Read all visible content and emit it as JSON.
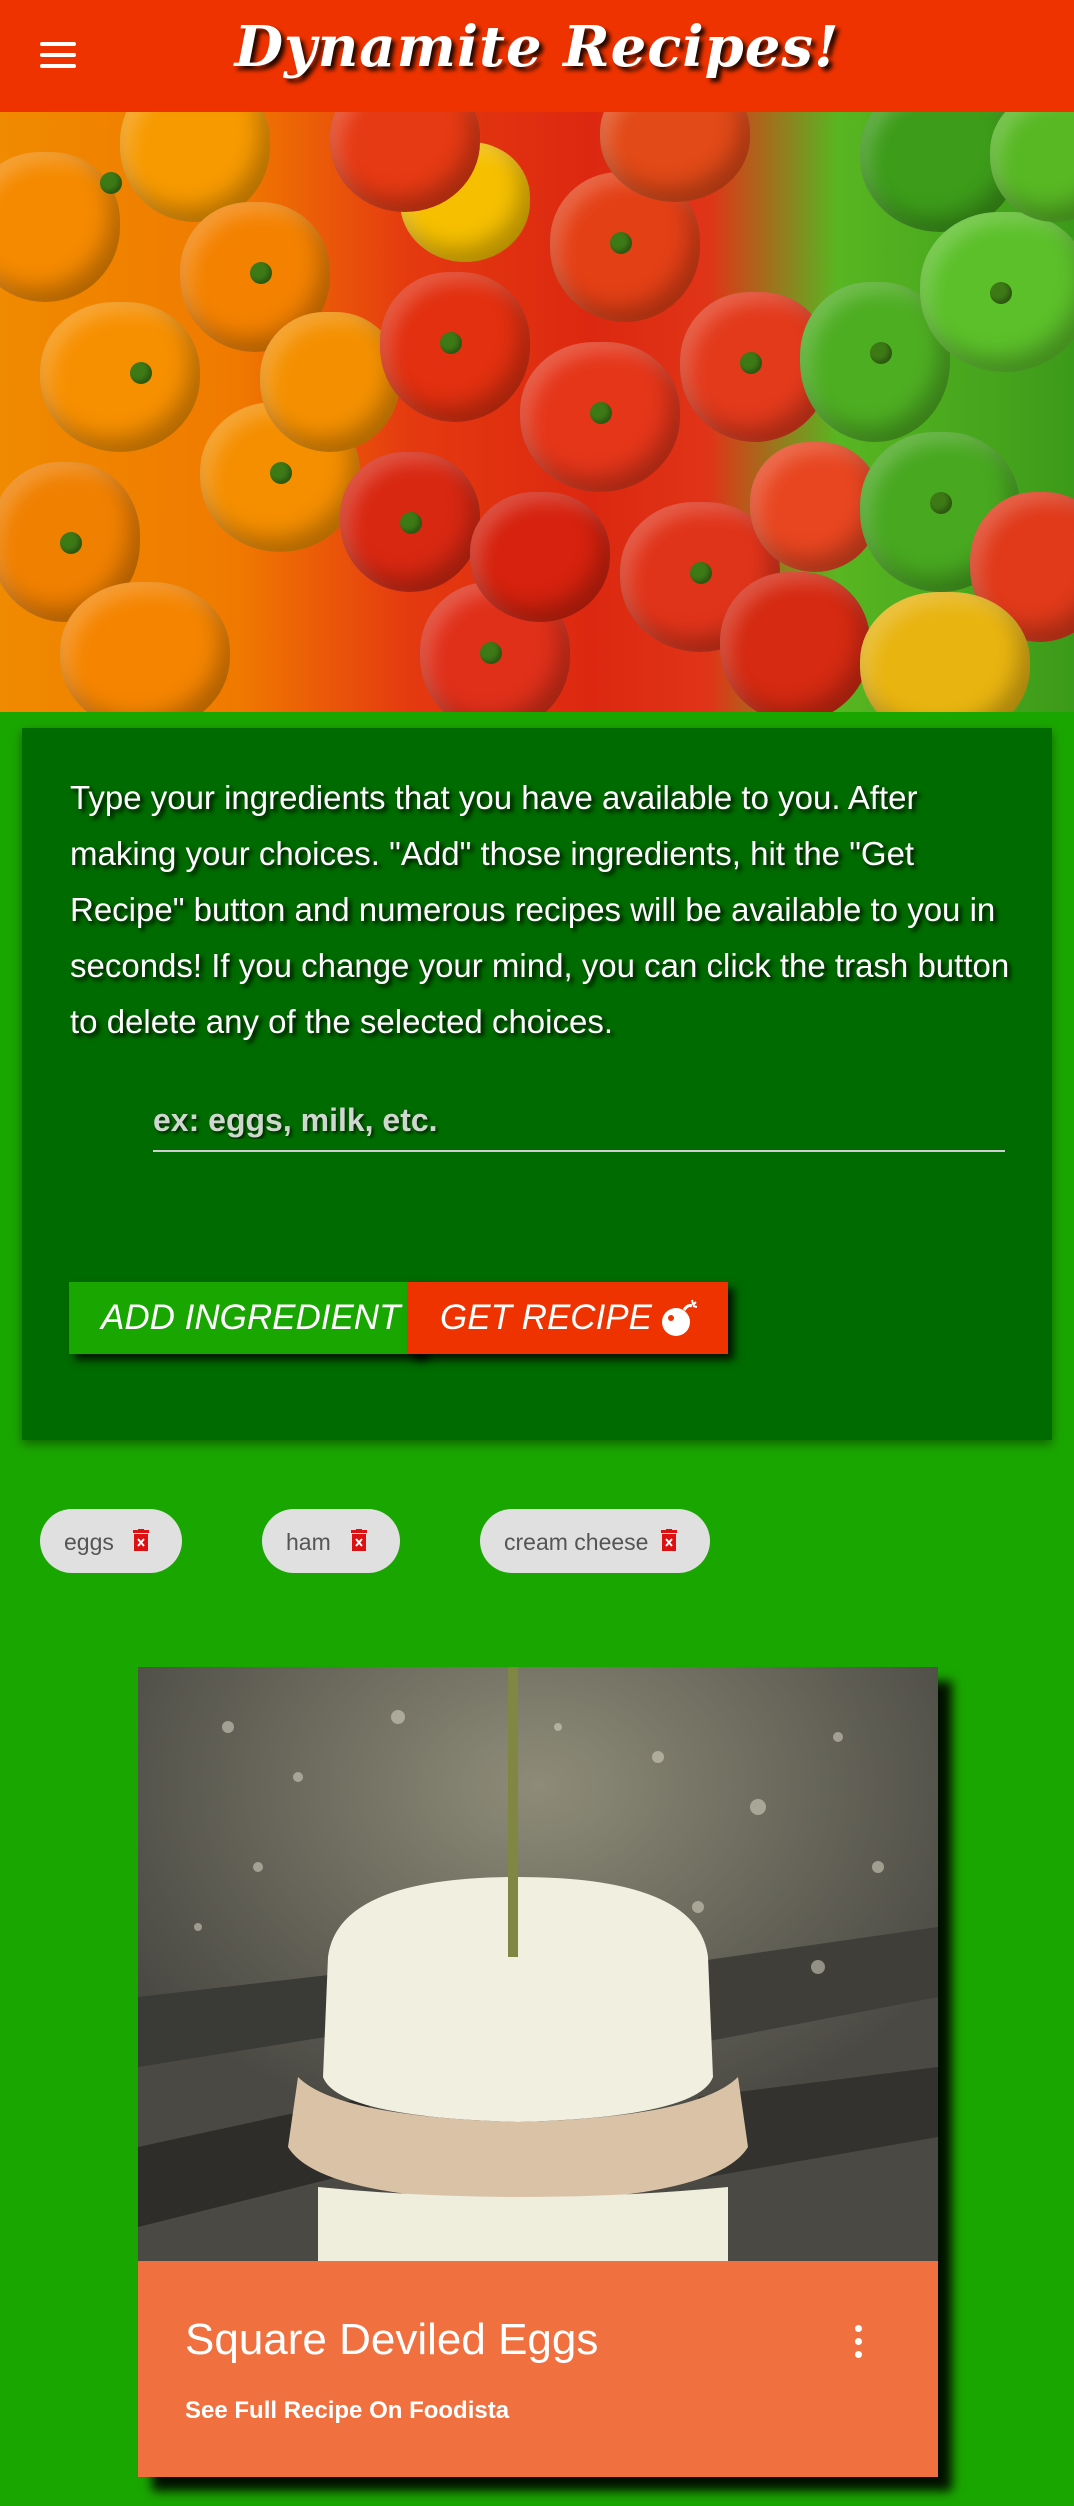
{
  "header": {
    "title": "Dynamite Recipes!",
    "menu_icon": "hamburger-menu-icon"
  },
  "hero": {
    "image": "peppers-banner"
  },
  "form": {
    "instructions": "Type your ingredients that you have available to you. After making your choices. \"Add\" those ingredients, hit the \"Get Recipe\" button and numerous recipes will be available to you in seconds! If you change your mind, you can click the trash button to delete any of the selected choices.",
    "input_placeholder": "ex: eggs, milk, etc.",
    "input_value": "",
    "add_button_label": "ADD INGREDIENT",
    "get_button_label": "GET RECIPE",
    "get_button_icon": "bomb-icon"
  },
  "chips": [
    {
      "label": "eggs"
    },
    {
      "label": "ham"
    },
    {
      "label": "cream cheese"
    }
  ],
  "recipe_card": {
    "title": "Square Deviled Eggs",
    "link_label": "See Full Recipe On Foodista",
    "menu_icon": "more-vert-icon"
  },
  "colors": {
    "header": "#ee3300",
    "page_background": "#1aa600",
    "panel": "#006b00",
    "add_button": "#1aa600",
    "get_button": "#ee3300",
    "card_footer": "#f07040",
    "chip": "#e0e0e0",
    "trash": "#dd1111"
  }
}
